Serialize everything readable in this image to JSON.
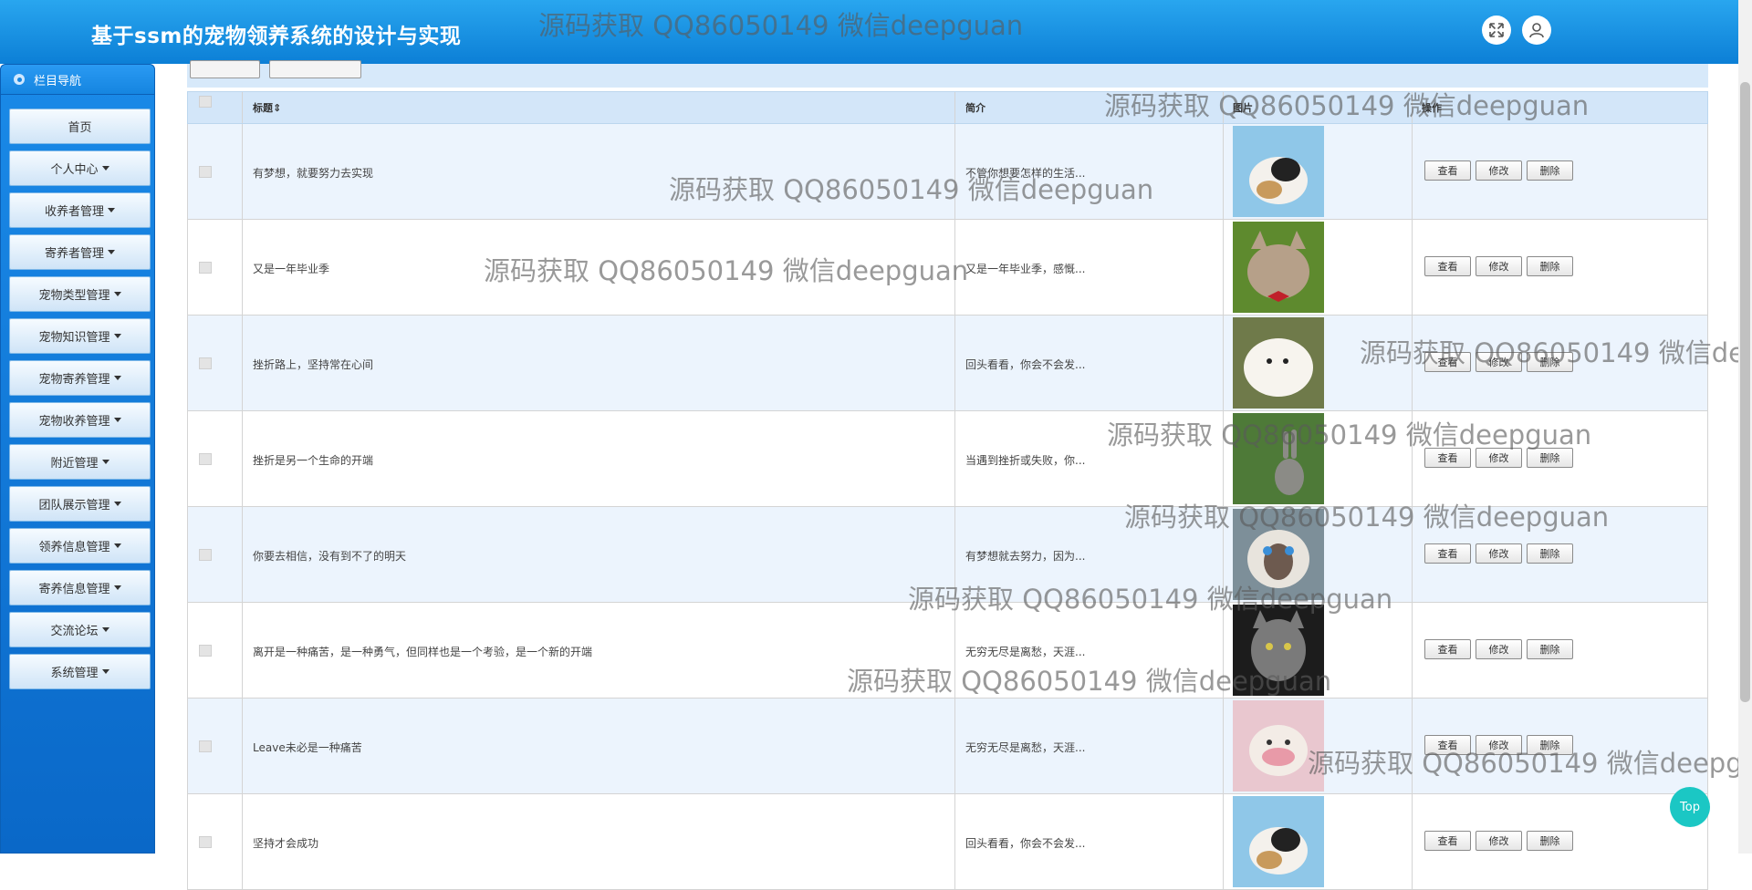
{
  "header": {
    "title": "基于ssm的宠物领养系统的设计与实现"
  },
  "sidebar": {
    "heading": "栏目导航",
    "items": [
      {
        "label": "首页",
        "caret": false
      },
      {
        "label": "个人中心",
        "caret": true
      },
      {
        "label": "收养者管理",
        "caret": true
      },
      {
        "label": "寄养者管理",
        "caret": true
      },
      {
        "label": "宠物类型管理",
        "caret": true
      },
      {
        "label": "宠物知识管理",
        "caret": true
      },
      {
        "label": "宠物寄养管理",
        "caret": true
      },
      {
        "label": "宠物收养管理",
        "caret": true
      },
      {
        "label": "附近管理",
        "caret": true
      },
      {
        "label": "团队展示管理",
        "caret": true
      },
      {
        "label": "领养信息管理",
        "caret": true
      },
      {
        "label": "寄养信息管理",
        "caret": true
      },
      {
        "label": "交流论坛",
        "caret": true
      },
      {
        "label": "系统管理",
        "caret": true
      }
    ]
  },
  "table": {
    "headers": {
      "title": "标题",
      "sort_icon": "⇕",
      "intro": "简介",
      "image": "图片",
      "actions": "操作"
    },
    "action_labels": {
      "view": "查看",
      "edit": "修改",
      "delete": "删除"
    },
    "rows": [
      {
        "title": "有梦想，就要努力去实现",
        "intro": "不管你想要怎样的生活...",
        "image": "guinea-pig"
      },
      {
        "title": "又是一年毕业季",
        "intro": "又是一年毕业季，感慨...",
        "image": "tabby-cat-bowtie"
      },
      {
        "title": "挫折路上，坚持常在心间",
        "intro": "回头看看，你会不会发...",
        "image": "white-dog"
      },
      {
        "title": "挫折是另一个生命的开端",
        "intro": "当遇到挫折或失败，你...",
        "image": "rabbit"
      },
      {
        "title": "你要去相信，没有到不了的明天",
        "intro": "有梦想就去努力，因为...",
        "image": "blue-eyed-cat"
      },
      {
        "title": "离开是一种痛苦，是一种勇气，但同样也是一个考验，是一个新的开端",
        "intro": "无穷无尽是离愁，天涯...",
        "image": "dark-cat"
      },
      {
        "title": "Leave未必是一种痛苦",
        "intro": "无穷无尽是离愁，天涯...",
        "image": "pink-kitten"
      },
      {
        "title": "坚持才会成功",
        "intro": "回头看看，你会不会发...",
        "image": "guinea-pig"
      }
    ]
  },
  "watermark": {
    "text": "源码获取 QQ86050149 微信deepguan"
  },
  "top_button": {
    "label": "Top"
  },
  "colors": {
    "header": "#1a8fe3",
    "sidebar": "#1178da",
    "row_alt": "#ecf4fd",
    "top_button": "#1bc7c4"
  }
}
